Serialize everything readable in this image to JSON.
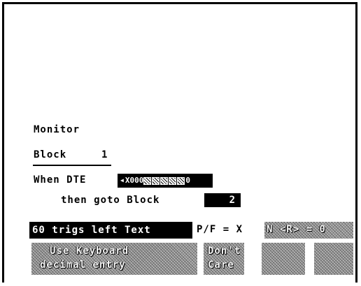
{
  "monitor_label": "Monitor",
  "block": {
    "label": "Block",
    "number": "1"
  },
  "when_dte": {
    "label": "When DTE",
    "prefix": "X000",
    "suffix": "0"
  },
  "then_goto": {
    "label": "then goto Block",
    "value": "2"
  },
  "status": {
    "trigs_text": "60 trigs left Text",
    "pf_text": "P/F = X",
    "n_r_text": "N <R> = 0"
  },
  "softkeys": {
    "keyboard_line1": "Use Keyboard",
    "keyboard_line2": "decimal entry",
    "dont_care_line1": "Don't",
    "dont_care_line2": "Care"
  }
}
